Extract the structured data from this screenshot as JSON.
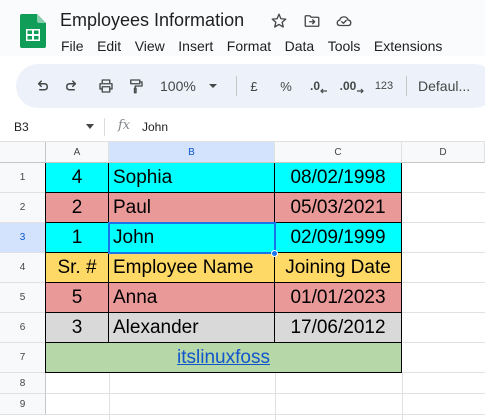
{
  "doc": {
    "title": "Employees Information"
  },
  "menu": [
    "File",
    "Edit",
    "View",
    "Insert",
    "Format",
    "Data",
    "Tools",
    "Extensions"
  ],
  "toolbar": {
    "zoom": "100%",
    "currency": "£",
    "percent": "%",
    "decrease_decimal": ".0",
    "increase_decimal": ".00",
    "number_format": "123",
    "font": "Defaul..."
  },
  "formula_bar": {
    "cell_ref": "B3",
    "fx": "fx",
    "content": "John"
  },
  "columns": [
    "A",
    "B",
    "C",
    "D"
  ],
  "rows": [
    "1",
    "2",
    "3",
    "4",
    "5",
    "6",
    "7",
    "8",
    "9"
  ],
  "colors": {
    "cyan": "#00ffff",
    "salmon": "#ea9999",
    "yellow": "#ffd966",
    "gray": "#d9d9d9",
    "green": "#b6d7a8",
    "selection": "#1a73e8"
  },
  "table": [
    {
      "num": "4",
      "name": "Sophia",
      "date": "08/02/1998",
      "bg": "cyan"
    },
    {
      "num": "2",
      "name": "Paul",
      "date": "05/03/2021",
      "bg": "salmon"
    },
    {
      "num": "1",
      "name": "John",
      "date": "02/09/1999",
      "bg": "cyan"
    },
    {
      "num": "Sr. #",
      "name": "Employee Name",
      "date": "Joining Date",
      "bg": "yellow"
    },
    {
      "num": "5",
      "name": "Anna",
      "date": "01/01/2023",
      "bg": "salmon"
    },
    {
      "num": "3",
      "name": "Alexander",
      "date": "17/06/2012",
      "bg": "gray"
    }
  ],
  "link_row": {
    "text": "itslinuxfoss",
    "bg": "green"
  },
  "selected_cell": "B3"
}
